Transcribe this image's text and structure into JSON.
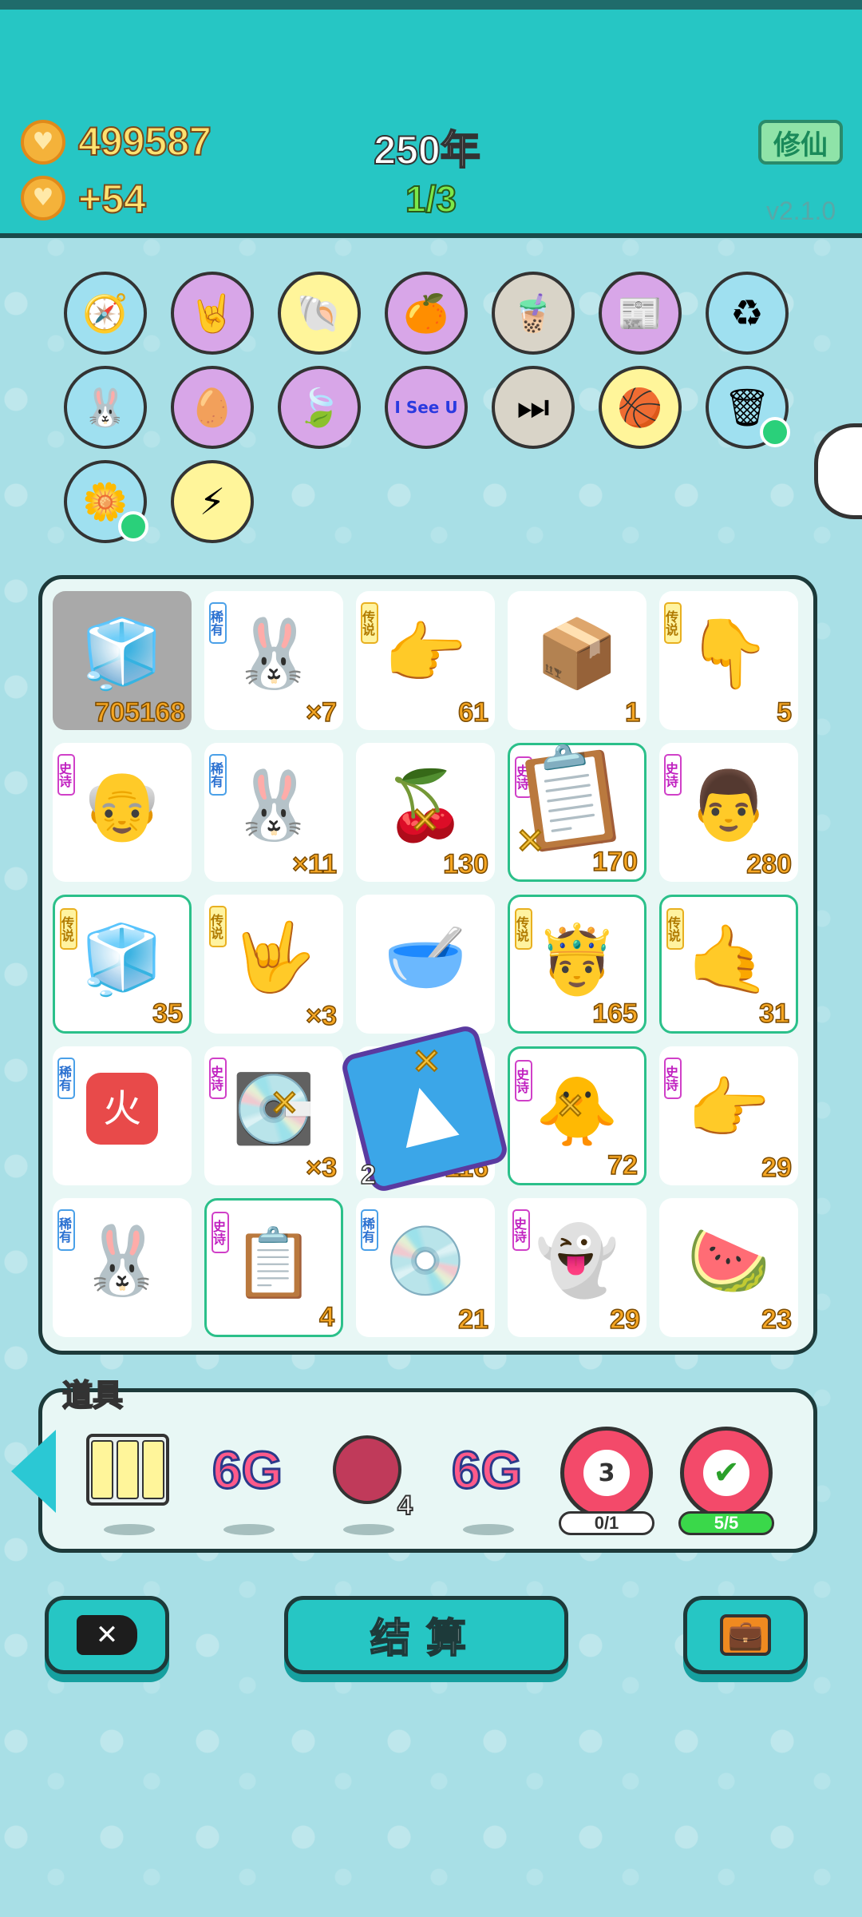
{
  "header": {
    "coins": "499587",
    "income": "+54",
    "year": "250年",
    "stage": "1/3",
    "cultivate_label": "修仙",
    "version": "v2.1.0"
  },
  "relics": [
    {
      "name": "compass",
      "glyph": "🧭",
      "bg": "#9fe0f0"
    },
    {
      "name": "rock-hand",
      "glyph": "🤘",
      "bg": "#d8a6e8"
    },
    {
      "name": "shell",
      "glyph": "🐚",
      "bg": "#fff59a"
    },
    {
      "name": "eyepatch-orange",
      "glyph": "🍊",
      "bg": "#d8a6e8"
    },
    {
      "name": "bubble-tea",
      "glyph": "🧋",
      "bg": "#d9d4c8"
    },
    {
      "name": "time-magazine",
      "glyph": "📰",
      "bg": "#d8a6e8"
    },
    {
      "name": "recycle-bag",
      "glyph": "♻",
      "bg": "#9fe0f0"
    },
    {
      "name": "rabbit",
      "glyph": "🐰",
      "bg": "#9fe0f0"
    },
    {
      "name": "egg",
      "glyph": "🥚",
      "bg": "#d8a6e8"
    },
    {
      "name": "leaf",
      "glyph": "🍃",
      "bg": "#d8a6e8"
    },
    {
      "name": "i-see-u",
      "glyph": "I See U",
      "bg": "#d8a6e8"
    },
    {
      "name": "skip",
      "glyph": "⏭",
      "bg": "#d9d4c8"
    },
    {
      "name": "basketballs",
      "glyph": "🏀",
      "bg": "#fff59a"
    },
    {
      "name": "trash-bag",
      "glyph": "🗑",
      "bg": "#9fe0f0"
    },
    {
      "name": "flower-pot",
      "glyph": "🌼",
      "bg": "#9fe0f0"
    },
    {
      "name": "lightning",
      "glyph": "⚡",
      "bg": "#fff59a"
    }
  ],
  "board": [
    {
      "rarity": "",
      "glyph": "🧊",
      "count": "705168"
    },
    {
      "rarity": "稀有",
      "glyph": "🐰",
      "count": "×7"
    },
    {
      "rarity": "传说",
      "glyph": "👉",
      "count": "61"
    },
    {
      "rarity": "",
      "glyph": "📦",
      "count": "1"
    },
    {
      "rarity": "传说",
      "glyph": "👇",
      "count": "5"
    },
    {
      "rarity": "史诗",
      "glyph": "👴",
      "count": ""
    },
    {
      "rarity": "稀有",
      "glyph": "🐰",
      "count": "×11"
    },
    {
      "rarity": "",
      "glyph": "🍒",
      "count": "130"
    },
    {
      "rarity": "史诗",
      "glyph": "📋",
      "count": "170"
    },
    {
      "rarity": "史诗",
      "glyph": "👨",
      "count": "280"
    },
    {
      "rarity": "传说",
      "glyph": "🧊",
      "count": "35"
    },
    {
      "rarity": "传说",
      "glyph": "🤟",
      "count": "×3"
    },
    {
      "rarity": "",
      "glyph": "🥣",
      "count": ""
    },
    {
      "rarity": "传说",
      "glyph": "🤴",
      "count": "165"
    },
    {
      "rarity": "传说",
      "glyph": "🤙",
      "count": "31"
    },
    {
      "rarity": "稀有",
      "glyph": "火",
      "count": ""
    },
    {
      "rarity": "史诗",
      "glyph": "💽",
      "count": "×3"
    },
    {
      "rarity": "",
      "glyph": "",
      "count": "116"
    },
    {
      "rarity": "史诗",
      "glyph": "🐥",
      "count": "72"
    },
    {
      "rarity": "史诗",
      "glyph": "👉",
      "count": "29"
    },
    {
      "rarity": "稀有",
      "glyph": "🐰",
      "count": ""
    },
    {
      "rarity": "史诗",
      "glyph": "📋",
      "count": "4"
    },
    {
      "rarity": "稀有",
      "glyph": "💿",
      "count": "21"
    },
    {
      "rarity": "史诗",
      "glyph": "👻",
      "count": "29"
    },
    {
      "rarity": "",
      "glyph": "🍉",
      "count": "23"
    }
  ],
  "board_extra": {
    "small_two": "2"
  },
  "props": {
    "title": "道具",
    "items": [
      {
        "name": "legend-cards",
        "glyph": "🀫"
      },
      {
        "name": "6g-1",
        "label": "6G"
      },
      {
        "name": "lychee",
        "glyph": "🍓",
        "count": "4"
      },
      {
        "name": "6g-2",
        "label": "6G"
      }
    ],
    "target_number": "3",
    "target_progress": "0/1",
    "check_progress": "5/5"
  },
  "buttons": {
    "delete_label": "✕",
    "settle_label": "结算",
    "bag_label": "💼"
  }
}
